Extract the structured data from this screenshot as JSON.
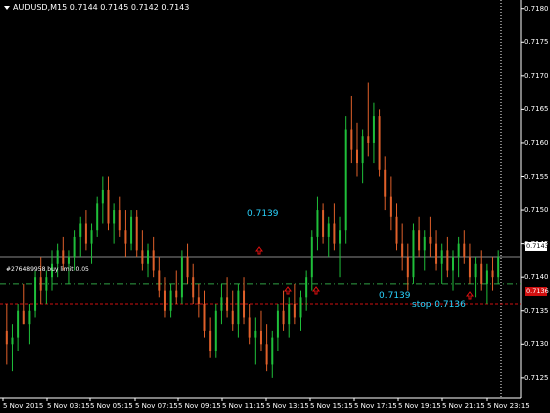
{
  "header": {
    "symbol": "AUDUSD,M15",
    "quotes": "0.7144 0.7145 0.7142 0.7143"
  },
  "price_axis": {
    "labels": [
      "0.7180",
      "0.7175",
      "0.7170",
      "0.7165",
      "0.7160",
      "0.7155",
      "0.7150",
      "0.7145",
      "0.7140",
      "0.7135",
      "0.7130",
      "0.7125"
    ],
    "current_price_tag": "0.7143",
    "stop_price_tag": "0.7136"
  },
  "time_axis": {
    "labels": [
      "5 Nov 2015",
      "5 Nov 03:15",
      "5 Nov 05:15",
      "5 Nov 07:15",
      "5 Nov 09:15",
      "5 Nov 11:15",
      "5 Nov 13:15",
      "5 Nov 15:15",
      "5 Nov 17:15",
      "5 Nov 19:15",
      "5 Nov 21:15",
      "5 Nov 23:15"
    ]
  },
  "annotations": {
    "order_label": "#276489958 buy limit 0.05",
    "price_label_top": "0.7139",
    "price_label_bottom": "0.7139",
    "stop_label": "stop 0.7136"
  },
  "colors": {
    "background": "#000000",
    "bull_candle": "#1fbf3a",
    "bear_candle": "#e0602a",
    "grid_line": "#888888",
    "order_line": "#2fa043",
    "stop_line": "#d01010",
    "annotation_text": "#2ad4ff",
    "arrow": "#e01010"
  },
  "chart_data": {
    "type": "candlestick",
    "ylim": [
      0.7122,
      0.7181
    ],
    "horizontal_levels": {
      "current": 0.7143,
      "buy_limit": 0.7139,
      "stop": 0.7136
    },
    "candles": [
      [
        0.7132,
        0.7136,
        0.7127,
        0.713
      ],
      [
        0.713,
        0.7133,
        0.7126,
        0.7131
      ],
      [
        0.7131,
        0.7136,
        0.7129,
        0.7135
      ],
      [
        0.7135,
        0.7139,
        0.7133,
        0.7133
      ],
      [
        0.7133,
        0.7136,
        0.713,
        0.7135
      ],
      [
        0.7135,
        0.7141,
        0.7134,
        0.714
      ],
      [
        0.714,
        0.7143,
        0.7136,
        0.7138
      ],
      [
        0.7138,
        0.7141,
        0.7136,
        0.714
      ],
      [
        0.714,
        0.7144,
        0.7138,
        0.7142
      ],
      [
        0.7142,
        0.7145,
        0.714,
        0.7144
      ],
      [
        0.7144,
        0.7146,
        0.7141,
        0.7142
      ],
      [
        0.7142,
        0.7144,
        0.7139,
        0.7143
      ],
      [
        0.7143,
        0.7147,
        0.7141,
        0.7146
      ],
      [
        0.7146,
        0.7149,
        0.7143,
        0.7148
      ],
      [
        0.7148,
        0.715,
        0.7144,
        0.7145
      ],
      [
        0.7145,
        0.7148,
        0.7142,
        0.7147
      ],
      [
        0.7147,
        0.7152,
        0.7146,
        0.7151
      ],
      [
        0.7151,
        0.7155,
        0.7148,
        0.7153
      ],
      [
        0.7153,
        0.7155,
        0.7147,
        0.7148
      ],
      [
        0.7148,
        0.7151,
        0.7145,
        0.715
      ],
      [
        0.715,
        0.7152,
        0.7146,
        0.7147
      ],
      [
        0.7147,
        0.715,
        0.7143,
        0.7145
      ],
      [
        0.7145,
        0.715,
        0.7144,
        0.7149
      ],
      [
        0.7149,
        0.715,
        0.7143,
        0.7144
      ],
      [
        0.7144,
        0.7147,
        0.7141,
        0.7142
      ],
      [
        0.7142,
        0.7145,
        0.714,
        0.7144
      ],
      [
        0.7144,
        0.7146,
        0.714,
        0.7141
      ],
      [
        0.7141,
        0.7143,
        0.7137,
        0.7138
      ],
      [
        0.7138,
        0.714,
        0.7134,
        0.7135
      ],
      [
        0.7135,
        0.7139,
        0.7134,
        0.7138
      ],
      [
        0.7138,
        0.7141,
        0.7136,
        0.7137
      ],
      [
        0.7137,
        0.7144,
        0.7136,
        0.7143
      ],
      [
        0.7143,
        0.7145,
        0.7139,
        0.714
      ],
      [
        0.714,
        0.7142,
        0.7136,
        0.7137
      ],
      [
        0.7137,
        0.7139,
        0.7134,
        0.7136
      ],
      [
        0.7136,
        0.7138,
        0.7131,
        0.7132
      ],
      [
        0.7132,
        0.7134,
        0.7128,
        0.7129
      ],
      [
        0.7129,
        0.7136,
        0.7128,
        0.7135
      ],
      [
        0.7135,
        0.7139,
        0.7133,
        0.7137
      ],
      [
        0.7137,
        0.714,
        0.7134,
        0.7135
      ],
      [
        0.7135,
        0.7138,
        0.7132,
        0.7133
      ],
      [
        0.7133,
        0.7139,
        0.7131,
        0.7138
      ],
      [
        0.7138,
        0.714,
        0.7133,
        0.7134
      ],
      [
        0.7134,
        0.7136,
        0.713,
        0.7131
      ],
      [
        0.7131,
        0.7134,
        0.7127,
        0.7132
      ],
      [
        0.7132,
        0.7135,
        0.7129,
        0.713
      ],
      [
        0.713,
        0.7133,
        0.7126,
        0.7127
      ],
      [
        0.7127,
        0.7132,
        0.7125,
        0.7131
      ],
      [
        0.7131,
        0.7136,
        0.7129,
        0.7135
      ],
      [
        0.7135,
        0.7138,
        0.7132,
        0.7133
      ],
      [
        0.7133,
        0.7137,
        0.7131,
        0.7136
      ],
      [
        0.7136,
        0.7139,
        0.7133,
        0.7134
      ],
      [
        0.7134,
        0.7138,
        0.7132,
        0.7137
      ],
      [
        0.7137,
        0.7141,
        0.7135,
        0.714
      ],
      [
        0.714,
        0.7147,
        0.7138,
        0.7146
      ],
      [
        0.7146,
        0.7152,
        0.7144,
        0.715
      ],
      [
        0.715,
        0.7151,
        0.7145,
        0.7146
      ],
      [
        0.7146,
        0.7149,
        0.7143,
        0.7148
      ],
      [
        0.7148,
        0.7151,
        0.7144,
        0.7145
      ],
      [
        0.7145,
        0.7149,
        0.714,
        0.7147
      ],
      [
        0.7147,
        0.7164,
        0.7145,
        0.7162
      ],
      [
        0.7162,
        0.7167,
        0.7157,
        0.7159
      ],
      [
        0.7159,
        0.7163,
        0.7155,
        0.7157
      ],
      [
        0.7157,
        0.7162,
        0.7154,
        0.7161
      ],
      [
        0.7161,
        0.7169,
        0.7158,
        0.716
      ],
      [
        0.716,
        0.7166,
        0.7157,
        0.7164
      ],
      [
        0.7164,
        0.7165,
        0.7155,
        0.7156
      ],
      [
        0.7156,
        0.7158,
        0.715,
        0.7152
      ],
      [
        0.7152,
        0.7155,
        0.7147,
        0.7149
      ],
      [
        0.7149,
        0.7151,
        0.7144,
        0.7145
      ],
      [
        0.7145,
        0.7148,
        0.7141,
        0.7143
      ],
      [
        0.7143,
        0.7145,
        0.7138,
        0.714
      ],
      [
        0.714,
        0.7148,
        0.7139,
        0.7147
      ],
      [
        0.7147,
        0.7149,
        0.7143,
        0.7144
      ],
      [
        0.7144,
        0.7147,
        0.7141,
        0.7146
      ],
      [
        0.7146,
        0.7149,
        0.7143,
        0.7145
      ],
      [
        0.7145,
        0.7147,
        0.7141,
        0.7142
      ],
      [
        0.7142,
        0.7145,
        0.7139,
        0.7144
      ],
      [
        0.7144,
        0.7146,
        0.714,
        0.7141
      ],
      [
        0.7141,
        0.7144,
        0.7138,
        0.7143
      ],
      [
        0.7143,
        0.7146,
        0.714,
        0.7145
      ],
      [
        0.7145,
        0.7147,
        0.7142,
        0.7143
      ],
      [
        0.7143,
        0.7145,
        0.7139,
        0.714
      ],
      [
        0.714,
        0.7143,
        0.7137,
        0.7142
      ],
      [
        0.7142,
        0.7144,
        0.7138,
        0.7139
      ],
      [
        0.7139,
        0.7142,
        0.7136,
        0.7141
      ],
      [
        0.7141,
        0.7143,
        0.7138,
        0.714
      ],
      [
        0.714,
        0.7144,
        0.7139,
        0.7143
      ]
    ]
  }
}
